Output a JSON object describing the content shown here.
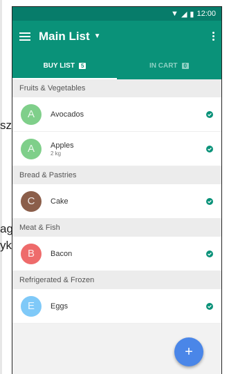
{
  "statusbar": {
    "time": "12:00"
  },
  "appbar": {
    "title": "Main List"
  },
  "tabs": [
    {
      "label": "BUY LIST",
      "count": "5"
    },
    {
      "label": "IN CART",
      "count": "0"
    }
  ],
  "sections": [
    {
      "title": "Fruits & Vegetables"
    },
    {
      "title": "Bread & Pastries"
    },
    {
      "title": "Meat & Fish"
    },
    {
      "title": "Refrigerated & Frozen"
    }
  ],
  "items": [
    {
      "initial": "A",
      "name": "Avocados",
      "sub": ""
    },
    {
      "initial": "A",
      "name": "Apples",
      "sub": "2 kg"
    },
    {
      "initial": "C",
      "name": "Cake",
      "sub": ""
    },
    {
      "initial": "B",
      "name": "Bacon",
      "sub": ""
    },
    {
      "initial": "E",
      "name": "Eggs",
      "sub": ""
    }
  ],
  "background_text": [
    "sz",
    "ag",
    "yk"
  ],
  "fab": {
    "label": "+"
  },
  "colors": {
    "primary": "#0a9279",
    "primary_dark": "#077c6a",
    "fab": "#4a86e8",
    "avatar_green": "#7fcf8a",
    "avatar_brown": "#8b5e4a",
    "avatar_red": "#ee6b6b",
    "avatar_blue": "#7fc9f8"
  }
}
